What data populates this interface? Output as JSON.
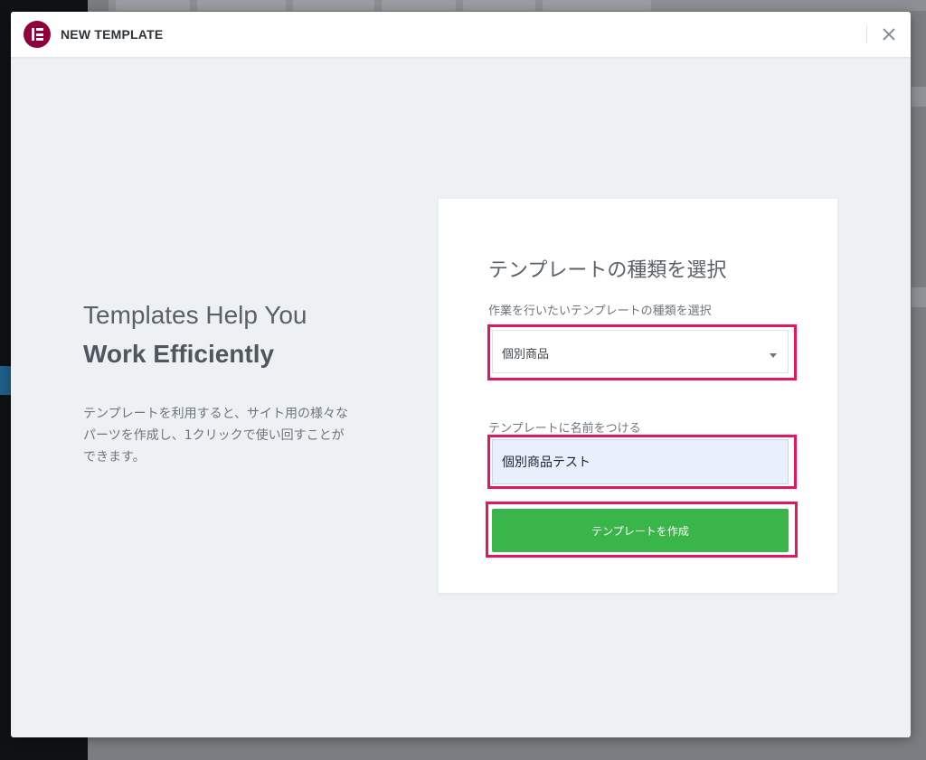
{
  "modal": {
    "title": "NEW TEMPLATE",
    "close_glyph": "✕"
  },
  "intro": {
    "heading_line1": "Templates Help You",
    "heading_line2": "Work Efficiently",
    "description": "テンプレートを利用すると、サイト用の様々なパーツを作成し、1クリックで使い回すことができます。"
  },
  "form": {
    "title": "テンプレートの種類を選択",
    "type_label": "作業を行いたいテンプレートの種類を選択",
    "type_selected": "個別商品",
    "name_label": "テンプレートに名前をつける",
    "name_value": "個別商品テスト",
    "submit_label": "テンプレートを作成"
  },
  "colors": {
    "brand": "#92003b",
    "submit": "#39b54a",
    "highlight": "#e5155f"
  },
  "icons": {
    "logo": "elementor-logo-icon",
    "close": "close-icon",
    "caret": "chevron-down-icon"
  }
}
